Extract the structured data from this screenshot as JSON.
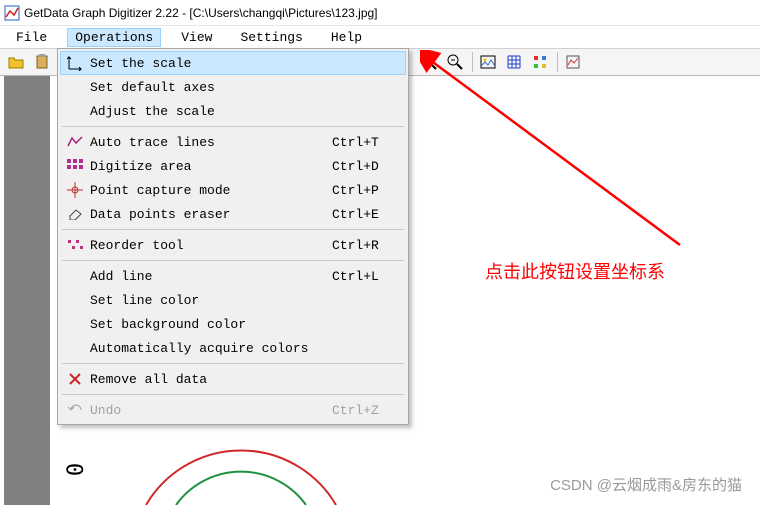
{
  "title": "GetData Graph Digitizer 2.22 - [C:\\Users\\changqi\\Pictures\\123.jpg]",
  "menubar": {
    "file": "File",
    "operations": "Operations",
    "view": "View",
    "settings": "Settings",
    "help": "Help"
  },
  "dropdown": {
    "set_scale": "Set the scale",
    "set_default_axes": "Set default axes",
    "adjust_scale": "Adjust the scale",
    "auto_trace": {
      "label": "Auto trace lines",
      "accel": "Ctrl+T"
    },
    "digitize_area": {
      "label": "Digitize area",
      "accel": "Ctrl+D"
    },
    "point_capture": {
      "label": "Point capture mode",
      "accel": "Ctrl+P"
    },
    "data_eraser": {
      "label": "Data points eraser",
      "accel": "Ctrl+E"
    },
    "reorder": {
      "label": "Reorder tool",
      "accel": "Ctrl+R"
    },
    "add_line": {
      "label": "Add line",
      "accel": "Ctrl+L"
    },
    "set_line_color": "Set line color",
    "set_bg_color": "Set background color",
    "auto_colors": "Automatically acquire colors",
    "remove_all": "Remove all data",
    "undo": {
      "label": "Undo",
      "accel": "Ctrl+Z"
    }
  },
  "annotation": "点击此按钮设置坐标系",
  "watermark": "CSDN @云烟成雨&房东的猫",
  "colors": {
    "highlight_bg": "#cce8ff",
    "highlight_border": "#99d1ff",
    "annotation": "#ff0000"
  }
}
